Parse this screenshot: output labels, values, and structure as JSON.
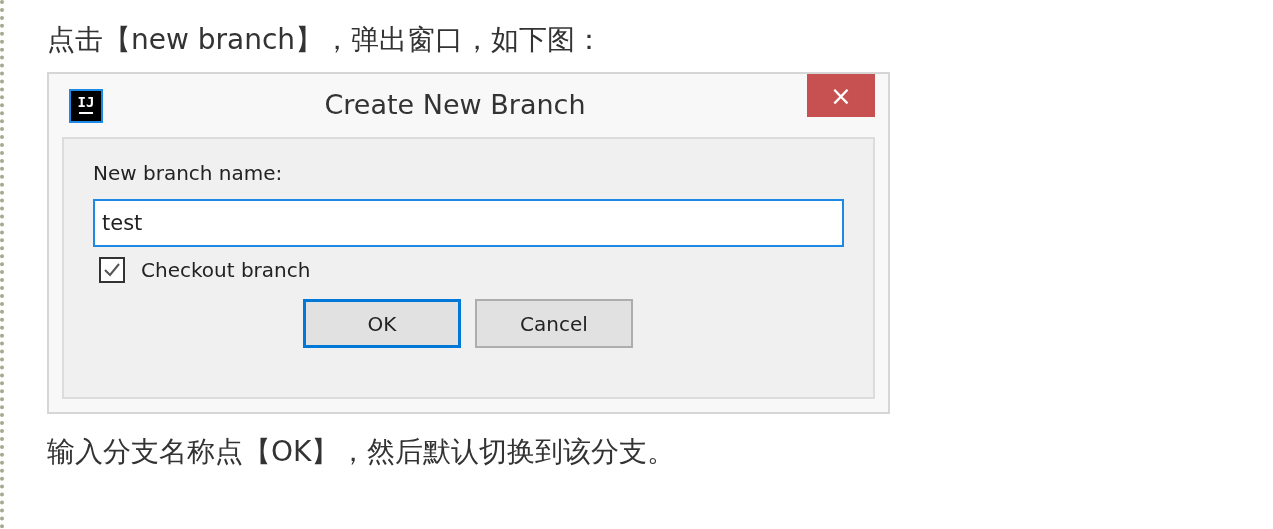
{
  "intro_text": "点击【new branch】，弹出窗口，如下图：",
  "dialog": {
    "app_icon_text": "IJ",
    "title": "Create New Branch",
    "close": "×",
    "label": "New branch name:",
    "value": "test",
    "checkbox": {
      "label": "Checkout branch",
      "checked": true
    },
    "buttons": [
      {
        "label": "OK",
        "selected": true
      },
      {
        "label": "Cancel",
        "selected": false
      }
    ]
  },
  "outro_text": "输入分支名称点【OK】，然后默认切换到该分支。"
}
